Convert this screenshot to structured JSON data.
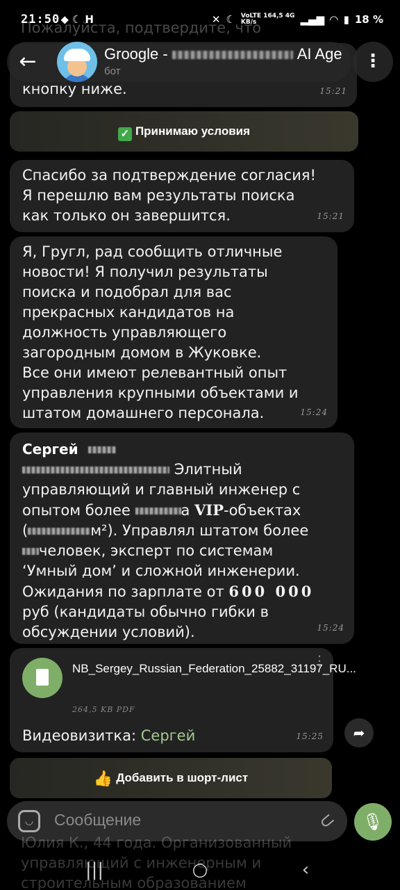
{
  "status_bar": {
    "time": "21:50",
    "left_icons": "⬥ ☾ H",
    "net_top": "VoLTE 164,5 4G",
    "net_bottom": "KB/s",
    "battery": "18 %"
  },
  "header": {
    "back_icon": "arrow-left",
    "title_start": "Groogle -",
    "title_end": "AI Age",
    "subtitle": "бот",
    "menu_icon": "more-vertical"
  },
  "messages": {
    "ghost_top": "Пожалуйста, подтвердите, что",
    "m1_tail": "кнопку ниже.",
    "m1_time": "15:21",
    "accept_button": "Принимаю условия",
    "m2_line1": "Спасибо за подтверждение согласия!",
    "m2_line2": "Я перешлю вам результаты поиска",
    "m2_line3": "как только он завершится.",
    "m2_time": "15:21",
    "m3_lines": [
      "Я, Гругл, рад сообщить отличные",
      "новости! Я получил результаты",
      "поиска и подобрал для вас",
      "прекрасных кандидатов на",
      "должность управляющего",
      "загородным домом в Жуковке.",
      "Все они имеют релевантный опыт",
      "управления крупными объектами и",
      "штатом домашнего персонала."
    ],
    "m3_time": "15:24",
    "m4_sender": "Сергей",
    "m4_l1": "Элитный",
    "m4_l2": "управляющий и главный инженер с",
    "m4_l3a": "опытом более",
    "m4_l3b": "а",
    "m4_l3c": "VIP",
    "m4_l3d": "-объектах",
    "m4_l4a": "(",
    "m4_l4b": "м²). Управлял штатом более",
    "m4_l5": "человек, эксперт по системам",
    "m4_l6": "‘Умный дом’ и сложной инженерии.",
    "m4_l7a": "Ожидания по зарплате от",
    "m4_l7b": "600 000",
    "m4_l8": "руб (кандидаты обычно гибки в",
    "m4_l9": "обсуждении условий).",
    "m4_time": "15:24",
    "file_name": "NB_Sergey_Russian_Federation_25882_31197_RU...",
    "file_size": "264,5 KB PDF",
    "caption_label": "Видеовизитка:",
    "caption_name": "Сергей",
    "m5_time": "15:25",
    "shortlist_button": "Добавить в шорт-лист"
  },
  "input": {
    "placeholder": "Сообщение"
  },
  "nav": {
    "ghost_line1": "Юлия К., 44 года. Организованный",
    "ghost_line2": "управляющий с инженерным и",
    "ghost_line3": "строительным образованием"
  },
  "colors": {
    "background": "#000000",
    "bubble": "#222222",
    "accent_green": "#7fae69",
    "name_green": "#a3c98f"
  }
}
